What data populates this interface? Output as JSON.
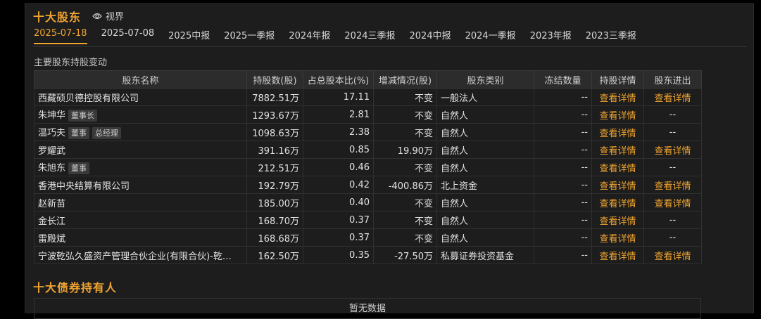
{
  "top_holders": {
    "title": "十大股东",
    "view_label": "视界",
    "tabs": [
      "2025-07-18",
      "2025-07-08",
      "2025中报",
      "2025一季报",
      "2024年报",
      "2024三季报",
      "2024中报",
      "2024一季报",
      "2023年报",
      "2023三季报"
    ],
    "active_tab": 0,
    "subtitle": "主要股东持股变动",
    "columns": [
      "股东名称",
      "持股数(股)",
      "占总股本比(%)",
      "增减情况(股)",
      "股东类别",
      "冻结数量",
      "持股详情",
      "股东进出"
    ],
    "rows": [
      {
        "name": "西藏硕贝德控股有限公司",
        "tags": [],
        "shares": "7882.51万",
        "ratio": "17.11",
        "change": "不变",
        "change_dir": "none",
        "type": "一般法人",
        "frozen": "--",
        "detail": "查看详情",
        "inout": "查看详情"
      },
      {
        "name": "朱坤华",
        "tags": [
          "董事长"
        ],
        "shares": "1293.67万",
        "ratio": "2.81",
        "change": "不变",
        "change_dir": "none",
        "type": "自然人",
        "frozen": "--",
        "detail": "查看详情",
        "inout": "--"
      },
      {
        "name": "温巧夫",
        "tags": [
          "董事",
          "总经理"
        ],
        "shares": "1098.63万",
        "ratio": "2.38",
        "change": "不变",
        "change_dir": "none",
        "type": "自然人",
        "frozen": "--",
        "detail": "查看详情",
        "inout": "--"
      },
      {
        "name": "罗耀武",
        "tags": [],
        "shares": "391.16万",
        "ratio": "0.85",
        "change": "19.90万",
        "change_dir": "up",
        "type": "自然人",
        "frozen": "--",
        "detail": "查看详情",
        "inout": "查看详情"
      },
      {
        "name": "朱旭东",
        "tags": [
          "董事"
        ],
        "shares": "212.51万",
        "ratio": "0.46",
        "change": "不变",
        "change_dir": "none",
        "type": "自然人",
        "frozen": "--",
        "detail": "查看详情",
        "inout": "--"
      },
      {
        "name": "香港中央结算有限公司",
        "tags": [],
        "shares": "192.79万",
        "ratio": "0.42",
        "change": "-400.86万",
        "change_dir": "down",
        "type": "北上资金",
        "frozen": "--",
        "detail": "查看详情",
        "inout": "查看详情"
      },
      {
        "name": "赵新苗",
        "tags": [],
        "shares": "185.00万",
        "ratio": "0.40",
        "change": "不变",
        "change_dir": "none",
        "type": "自然人",
        "frozen": "--",
        "detail": "查看详情",
        "inout": "查看详情"
      },
      {
        "name": "金长江",
        "tags": [],
        "shares": "168.70万",
        "ratio": "0.37",
        "change": "不变",
        "change_dir": "none",
        "type": "自然人",
        "frozen": "--",
        "detail": "查看详情",
        "inout": "--"
      },
      {
        "name": "雷殿斌",
        "tags": [],
        "shares": "168.68万",
        "ratio": "0.37",
        "change": "不变",
        "change_dir": "none",
        "type": "自然人",
        "frozen": "--",
        "detail": "查看详情",
        "inout": "--"
      },
      {
        "name": "宁波乾弘久盛资产管理合伙企业(有限合伙)-乾…",
        "tags": [],
        "shares": "162.50万",
        "ratio": "0.35",
        "change": "-27.50万",
        "change_dir": "down",
        "type": "私募证券投资基金",
        "frozen": "--",
        "detail": "查看详情",
        "inout": "查看详情"
      }
    ]
  },
  "bond_holders": {
    "title": "十大债券持有人",
    "empty_text": "暂无数据"
  },
  "colors": {
    "accent": "#f0a430",
    "up": "#e23b3b",
    "down": "#3fbf3f",
    "background": "#1d1d1d"
  }
}
